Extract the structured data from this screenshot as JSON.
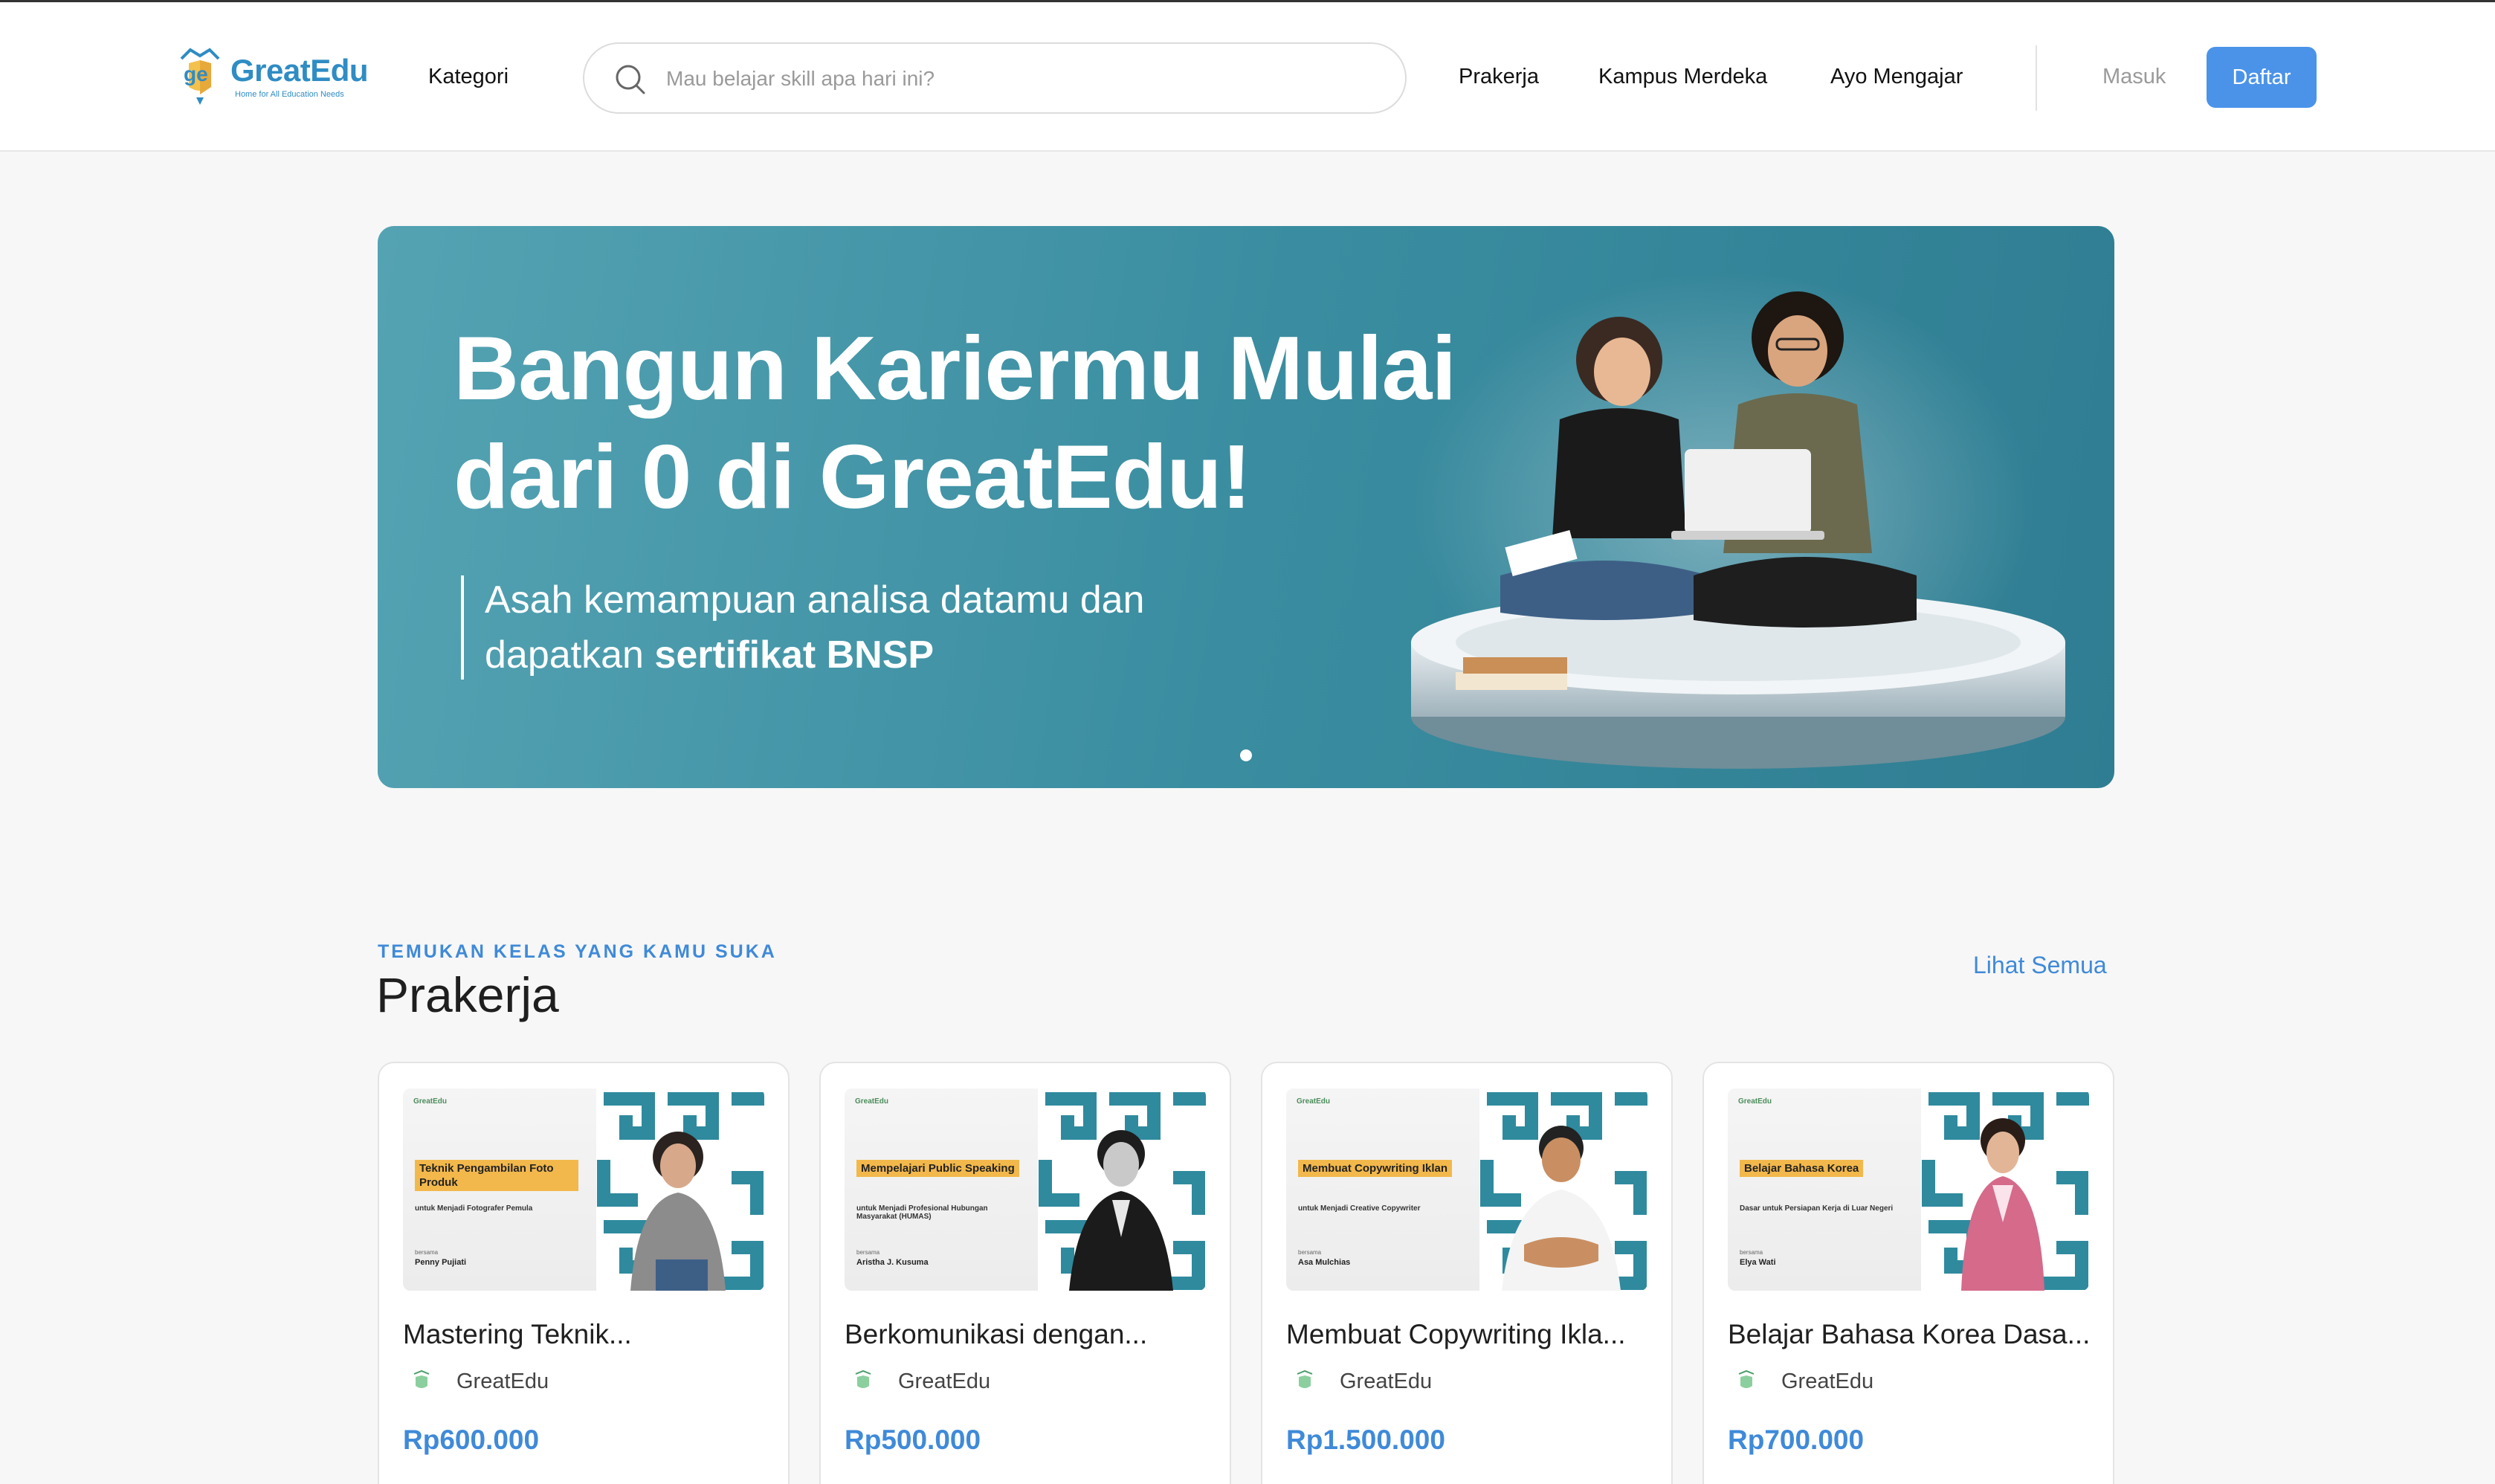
{
  "header": {
    "logo_text": "GreatEdu",
    "logo_tagline": "Home for All Education Needs",
    "kategori": "Kategori",
    "search": {
      "placeholder": "Mau belajar skill apa hari ini?",
      "value": ""
    },
    "nav": [
      "Prakerja",
      "Kampus Merdeka",
      "Ayo Mengajar"
    ],
    "login": "Masuk",
    "register": "Daftar"
  },
  "banner": {
    "headline_line1": "Bangun Kariermu Mulai",
    "headline_line2": "dari 0 di GreatEdu!",
    "sub_line1": "Asah kemampuan analisa datamu dan",
    "sub_line2_prefix": "dapatkan ",
    "sub_line2_bold": "sertifikat BNSP",
    "slide_count": 1,
    "active_slide": 1
  },
  "section": {
    "eyebrow": "TEMUKAN KELAS YANG KAMU SUKA",
    "title": "Prakerja",
    "see_all": "Lihat Semua"
  },
  "courses": [
    {
      "title": "Mastering Teknik...",
      "provider": "GreatEdu",
      "price": "Rp600.000",
      "thumb": {
        "brand": "GreatEdu",
        "tag": "Teknik Pengambilan Foto Produk",
        "desc": "untuk Menjadi Fotografer Pemula",
        "by": "bersama",
        "person": "Penny Pujiati"
      }
    },
    {
      "title": "Berkomunikasi dengan...",
      "provider": "GreatEdu",
      "price": "Rp500.000",
      "thumb": {
        "brand": "GreatEdu",
        "tag": "Mempelajari Public Speaking",
        "desc": "untuk Menjadi Profesional Hubungan Masyarakat (HUMAS)",
        "by": "bersama",
        "person": "Aristha J. Kusuma"
      }
    },
    {
      "title": "Membuat Copywriting Ikla...",
      "provider": "GreatEdu",
      "price": "Rp1.500.000",
      "thumb": {
        "brand": "GreatEdu",
        "tag": "Membuat Copywriting Iklan",
        "desc": "untuk Menjadi Creative Copywriter",
        "by": "bersama",
        "person": "Asa Mulchias"
      }
    },
    {
      "title": "Belajar Bahasa Korea Dasa...",
      "provider": "GreatEdu",
      "price": "Rp700.000",
      "thumb": {
        "brand": "GreatEdu",
        "tag": "Belajar Bahasa Korea",
        "desc": "Dasar untuk Persiapan Kerja di Luar Negeri",
        "by": "bersama",
        "person": "Elya Wati"
      }
    }
  ],
  "colors": {
    "accent": "#4a93e9",
    "link": "#3f8ad9",
    "banner": "#3a8da0",
    "tag": "#f2b84b",
    "pattern": "#2f8a9e"
  },
  "icons": {
    "search": "search-icon",
    "provider": "greatedu-logo-icon"
  }
}
